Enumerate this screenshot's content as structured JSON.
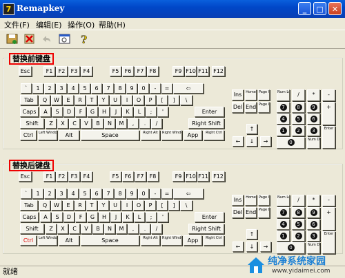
{
  "window": {
    "title": "Remapkey",
    "app_icon": "7",
    "minimize": "_",
    "maximize": "□",
    "close": "✕"
  },
  "menu": [
    {
      "name": "menu-file",
      "label": "文件(F)"
    },
    {
      "name": "menu-edit",
      "label": "编辑(E)"
    },
    {
      "name": "menu-action",
      "label": "操作(O)"
    },
    {
      "name": "menu-help",
      "label": "帮助(H)"
    }
  ],
  "toolbar": [
    {
      "name": "save-icon",
      "enabled": true
    },
    {
      "name": "delete-icon",
      "enabled": true
    },
    {
      "name": "undo-icon",
      "enabled": false
    },
    {
      "name": "view-icon",
      "enabled": true
    },
    {
      "name": "help-icon",
      "enabled": true
    }
  ],
  "groups": {
    "before": {
      "label": "替换前键盘"
    },
    "after": {
      "label": "替换后键盘"
    }
  },
  "status": {
    "text": "就绪"
  },
  "watermark": {
    "text": "纯净系统家园",
    "url": "www.yidaimei.com"
  },
  "keyboard": {
    "row_f": [
      "Esc",
      "F1",
      "F2",
      "F3",
      "F4",
      "F5",
      "F6",
      "F7",
      "F8",
      "F9",
      "F10",
      "F11",
      "F12"
    ],
    "row_1": [
      "`",
      "1",
      "2",
      "3",
      "4",
      "5",
      "6",
      "7",
      "8",
      "9",
      "0",
      "-",
      "=",
      "⇦"
    ],
    "row_2": [
      "Tab",
      "Q",
      "W",
      "E",
      "R",
      "T",
      "Y",
      "U",
      "I",
      "O",
      "P",
      "[",
      "]",
      "\\"
    ],
    "row_3": [
      "Caps",
      "A",
      "S",
      "D",
      "F",
      "G",
      "H",
      "J",
      "K",
      "L",
      ";",
      "'",
      "Enter"
    ],
    "row_4": [
      "Shift",
      "Z",
      "X",
      "C",
      "V",
      "B",
      "N",
      "M",
      ",",
      ".",
      "/",
      "Right Shift"
    ],
    "row_5": [
      "Ctrl",
      "Left Windows",
      "Alt",
      "Space",
      "Right Alt",
      "Right Windows",
      "App",
      "Right Ctrl"
    ],
    "nav": [
      "Ins",
      "Home",
      "Page Up",
      "Del",
      "End",
      "Page Down"
    ],
    "arrows": [
      "↑",
      "←",
      "↓",
      "→"
    ],
    "numpad": [
      "Num Lock",
      "/",
      "*",
      "-",
      "7",
      "8",
      "9",
      "+",
      "4",
      "5",
      "6",
      "1",
      "2",
      "3",
      "Enter",
      "0",
      "Num Del"
    ],
    "after_ctrl_left": "Ctrl"
  },
  "colors": {
    "highlight": "#e00000",
    "title_bar": "#0a55dc",
    "face": "#ece9d8"
  }
}
